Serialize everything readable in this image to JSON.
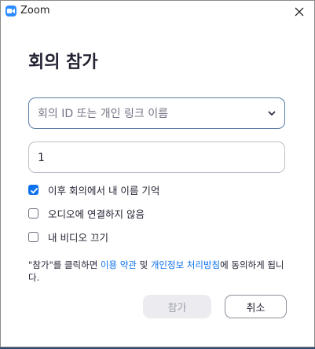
{
  "window": {
    "title": "Zoom",
    "close_icon": "close-icon",
    "app_icon": "zoom-camera-icon"
  },
  "dialog": {
    "heading": "회의 참가",
    "meeting_field": {
      "placeholder": "회의 ID 또는 개인 링크 이름",
      "dropdown_icon": "chevron-down-icon"
    },
    "name_field": {
      "value": "1"
    },
    "options": [
      {
        "label": "이후 회의에서 내 이름 기억",
        "checked": true
      },
      {
        "label": "오디오에 연결하지 않음",
        "checked": false
      },
      {
        "label": "내 비디오 끄기",
        "checked": false
      }
    ],
    "terms": {
      "prefix": "\"참가\"를 클릭하면 ",
      "terms_link": "이용 약관",
      "conjunction": " 및 ",
      "privacy_link": "개인정보 처리방침",
      "suffix": "에 동의하게 됩니다."
    },
    "buttons": {
      "join": "참가",
      "cancel": "취소"
    }
  },
  "colors": {
    "accent": "#0e72ed",
    "zoom_brand": "#2d8cff",
    "disabled_button_bg": "#ececf0",
    "disabled_button_text": "#9d9dab"
  }
}
